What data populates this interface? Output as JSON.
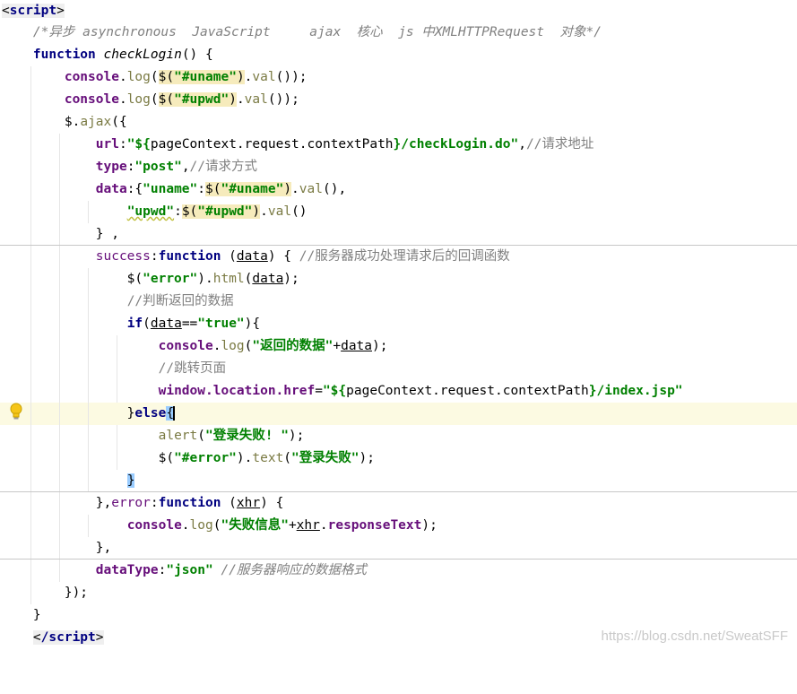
{
  "editor": {
    "open_tag": "script",
    "close_tag": "/script",
    "comment_async": "/*异步 asynchronous  JavaScript     ajax  核心  js 中XMLHTTPRequest  对象*/",
    "kw_function": "function",
    "fn_name": "checkLogin",
    "console": "console",
    "log": "log",
    "uname_sel": "\"#uname\"",
    "upwd_sel": "\"#upwd\"",
    "val": "val",
    "ajax": "ajax",
    "url_key": "url",
    "url_prefix": "\"${",
    "url_ctx": "pageContext.request.contextPath",
    "url_suffix": "}/checkLogin.do\"",
    "comment_url": "//请求地址",
    "type_key": "type",
    "type_val": "\"post\"",
    "comment_type": "//请求方式",
    "data_key": "data",
    "uname_key": "\"uname\"",
    "upwd_key": "\"upwd\"",
    "success_key": "success",
    "param_data": "data",
    "comment_success": "//服务器成功处理请求后的回调函数",
    "error_sel": "\"error\"",
    "html": "html",
    "comment_judge": "//判断返回的数据",
    "kw_if": "if",
    "true_str": "\"true\"",
    "returned_data": "\"返回的数据\"",
    "comment_redirect": "//跳转页面",
    "window_href": "window.location.href",
    "href_prefix": "\"${",
    "href_ctx": "pageContext.request.contextPath",
    "href_suffix": "}/index.jsp\"",
    "kw_else": "else",
    "alert": "alert",
    "login_fail_excl": "\"登录失败! \"",
    "hash_error": "\"#error\"",
    "text": "text",
    "login_fail": "\"登录失败\"",
    "error_key": "error",
    "param_xhr": "xhr",
    "fail_info": "\"失败信息\"",
    "response_text": "responseText",
    "datatype_key": "dataType",
    "json_str": "\"json\"",
    "comment_datatype": "//服务器响应的数据格式"
  },
  "watermark": "https://blog.csdn.net/SweatSFF",
  "icons": {
    "bulb": "lightbulb-icon"
  }
}
